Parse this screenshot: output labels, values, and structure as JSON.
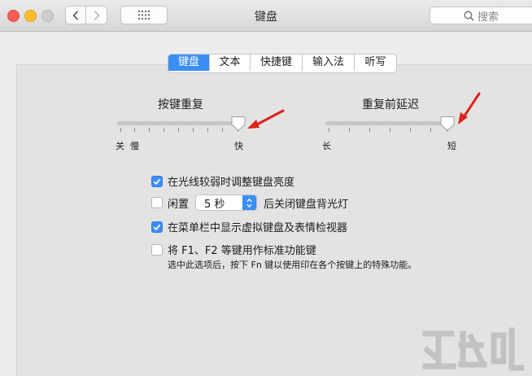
{
  "window": {
    "title": "键盘"
  },
  "search": {
    "placeholder": "搜索",
    "icon": "magnifier-icon"
  },
  "tabs": [
    {
      "label": "键盘",
      "active": true
    },
    {
      "label": "文本",
      "active": false
    },
    {
      "label": "快捷键",
      "active": false
    },
    {
      "label": "输入法",
      "active": false
    },
    {
      "label": "听写",
      "active": false
    }
  ],
  "key_repeat": {
    "title": "按键重复",
    "min_label_off": "关",
    "min_label_slow": "慢",
    "max_label": "快",
    "value_fraction": 1.0
  },
  "repeat_delay": {
    "title": "重复前延迟",
    "min_label": "长",
    "max_label": "短",
    "value_fraction": 1.0
  },
  "options": {
    "auto_brightness": {
      "label": "在光线较弱时调整键盘亮度",
      "checked": true
    },
    "backlight_idle": {
      "prefix": "闲置",
      "value": "5 秒",
      "suffix": "后关闭键盘背光灯",
      "checked": false
    },
    "show_viewer": {
      "label": "在菜单栏中显示虚拟键盘及表情检视器",
      "checked": true
    },
    "fn_keys": {
      "label": "将 F1、F2 等键用作标准功能键",
      "checked": false,
      "description": "选中此选项后，按下 Fn 键以使用印在各个按键上的特殊功能。"
    }
  },
  "colors": {
    "accent": "#3a8ef6",
    "annotation_arrow": "#e0201b"
  }
}
